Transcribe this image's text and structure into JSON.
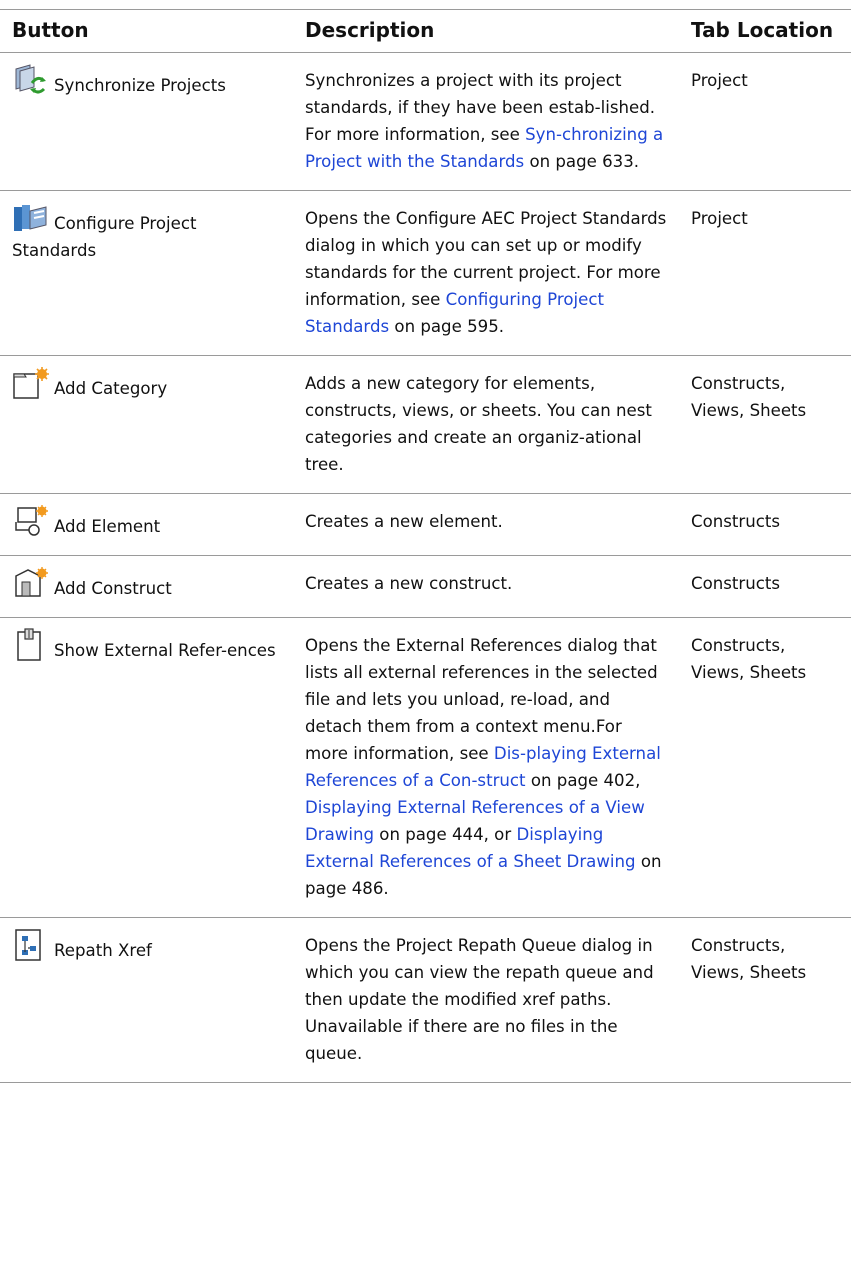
{
  "headers": {
    "button": "Button",
    "description": "Description",
    "tab_location": "Tab Location"
  },
  "rows": [
    {
      "icon": "synchronize-projects-icon",
      "button": "Synchronize Projects",
      "desc_before": "Synchronizes a project with its project standards, if they have been estab-lished. For more information, see ",
      "links": [
        {
          "text": "Syn-chronizing a Project with the Standards",
          "after": " on page 633."
        }
      ],
      "tab": "Project"
    },
    {
      "icon": "configure-project-standards-icon",
      "button": "Configure Project Standards",
      "desc_before": "Opens the Configure AEC Project Standards dialog in which you can set up or modify standards for the current project. For more information, see ",
      "links": [
        {
          "text": "Configuring Project Standards",
          "after": " on page 595."
        }
      ],
      "tab": "Project"
    },
    {
      "icon": "add-category-icon",
      "button": "Add Category",
      "desc_before": "Adds a new category for elements, constructs, views, or sheets. You can nest categories and create an organiz-ational tree.",
      "links": [],
      "tab": "Constructs, Views, Sheets"
    },
    {
      "icon": "add-element-icon",
      "button": "Add Element",
      "desc_before": "Creates a new element.",
      "links": [],
      "tab": "Constructs"
    },
    {
      "icon": "add-construct-icon",
      "button": "Add Construct",
      "desc_before": "Creates a new construct.",
      "links": [],
      "tab": "Constructs"
    },
    {
      "icon": "show-external-references-icon",
      "button": "Show External Refer-ences",
      "desc_before": "Opens the External References dialog that lists all external references in the selected file and lets you unload, re-load, and detach them from a context menu.For more information, see ",
      "links": [
        {
          "text": "Dis-playing External References of a Con-struct",
          "after": " on page 402, "
        },
        {
          "text": "Displaying External References of a View Drawing",
          "after": " on page 444, or "
        },
        {
          "text": "Displaying External References of a Sheet Drawing",
          "after": " on page 486."
        }
      ],
      "tab": "Constructs, Views, Sheets"
    },
    {
      "icon": "repath-xref-icon",
      "button": "Repath Xref",
      "desc_before": "Opens the Project Repath Queue dialog in which you can view the repath queue and then update the modified xref paths. Unavailable if there are no files in the queue.",
      "links": [],
      "tab": "Constructs, Views, Sheets"
    }
  ]
}
